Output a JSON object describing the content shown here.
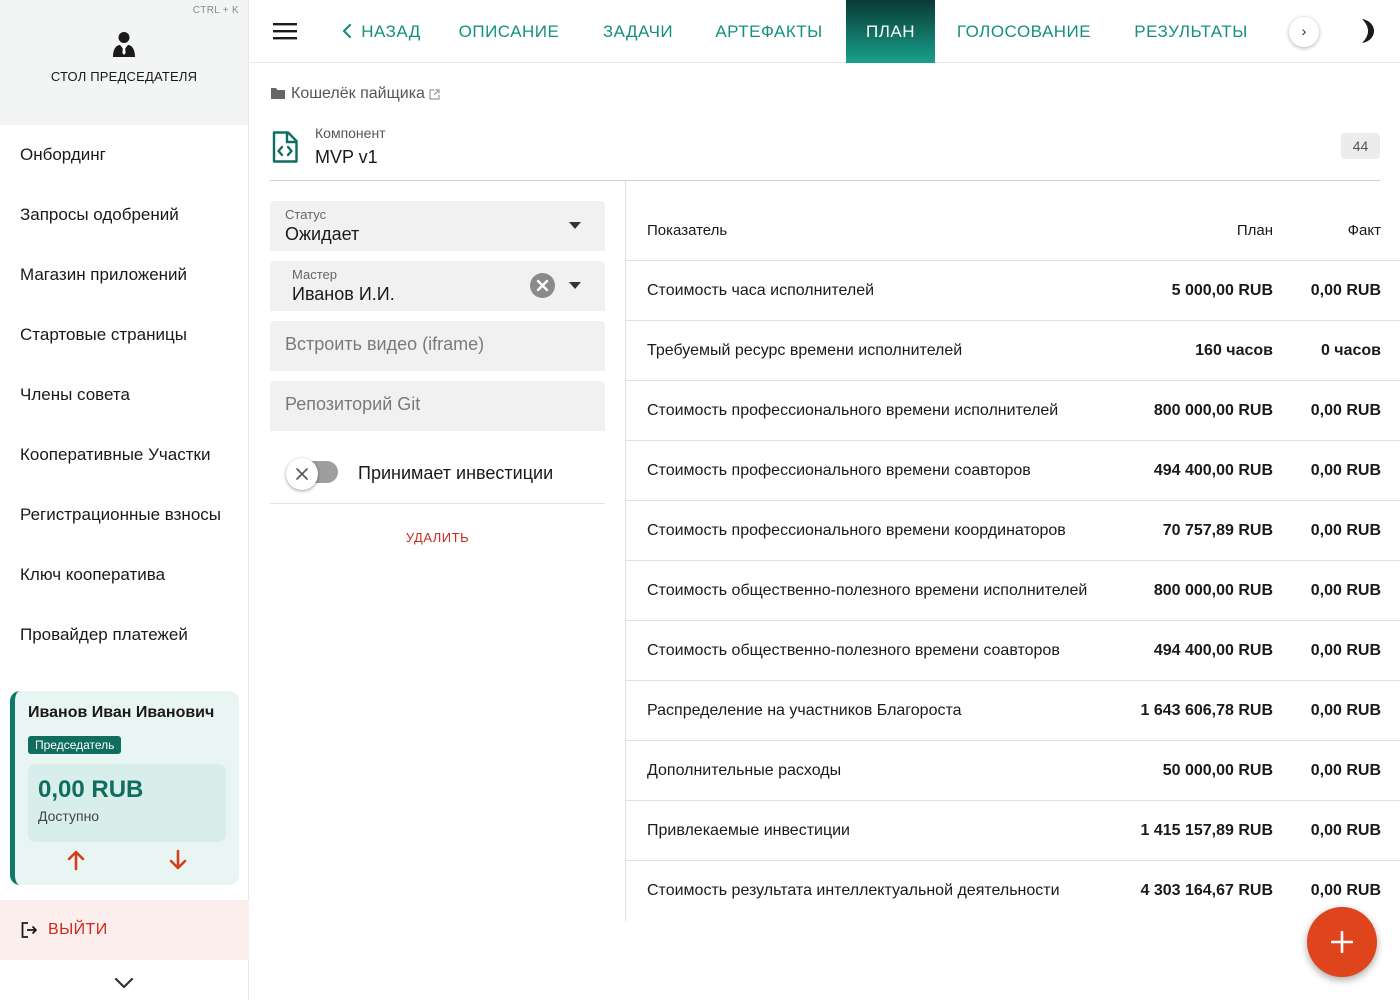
{
  "sidebar": {
    "shortcut": "CTRL + K",
    "workspace_title": "СТОЛ ПРЕДСЕДАТЕЛЯ",
    "items": [
      {
        "label": "Онбординг"
      },
      {
        "label": "Запросы одобрений"
      },
      {
        "label": "Магазин приложений"
      },
      {
        "label": "Стартовые страницы"
      },
      {
        "label": "Члены совета"
      },
      {
        "label": "Кооперативные Участки"
      },
      {
        "label": "Регистрационные взносы"
      },
      {
        "label": "Ключ кооператива"
      },
      {
        "label": "Провайдер платежей"
      }
    ],
    "user": {
      "name": "Иванов Иван Иванович",
      "role": "Председатель",
      "balance": "0,00 RUB",
      "balance_label": "Доступно"
    },
    "logout_label": "ВЫЙТИ"
  },
  "topbar": {
    "back_label": "НАЗАД",
    "tabs": [
      {
        "label": "ОПИСАНИЕ"
      },
      {
        "label": "ЗАДАЧИ"
      },
      {
        "label": "АРТЕФАКТЫ"
      },
      {
        "label": "ПЛАН"
      },
      {
        "label": "ГОЛОСОВАНИЕ"
      },
      {
        "label": "РЕЗУЛЬТАТЫ"
      }
    ],
    "active_tab": "ПЛАН",
    "scroll_glyph": "›"
  },
  "header": {
    "breadcrumb": "Кошелёк пайщика",
    "component_type": "Компонент",
    "component_name": "MVP v1",
    "badge": "44"
  },
  "form": {
    "status_label": "Статус",
    "status_value": "Ожидает",
    "master_label": "Мастер",
    "master_value": "Иванов И.И.",
    "video_placeholder": "Встроить видео (iframe)",
    "git_placeholder": "Репозиторий Git",
    "invest_toggle_label": "Принимает инвестиции",
    "invest_toggle_on": false,
    "delete_label": "УДАЛИТЬ"
  },
  "table": {
    "headers": {
      "name": "Показатель",
      "plan": "План",
      "fact": "Факт"
    },
    "rows": [
      {
        "name": "Стоимость часа исполнителей",
        "plan": "5 000,00 RUB",
        "fact": "0,00 RUB"
      },
      {
        "name": "Требуемый ресурс времени исполнителей",
        "plan": "160 часов",
        "fact": "0 часов"
      },
      {
        "name": "Стоимость профессионального времени исполнителей",
        "plan": "800 000,00 RUB",
        "fact": "0,00 RUB"
      },
      {
        "name": "Стоимость профессионального времени соавторов",
        "plan": "494 400,00 RUB",
        "fact": "0,00 RUB"
      },
      {
        "name": "Стоимость профессионального времени координаторов",
        "plan": "70 757,89 RUB",
        "fact": "0,00 RUB"
      },
      {
        "name": "Стоимость общественно-полезного времени исполнителей",
        "plan": "800 000,00 RUB",
        "fact": "0,00 RUB"
      },
      {
        "name": "Стоимость общественно-полезного времени соавторов",
        "plan": "494 400,00 RUB",
        "fact": "0,00 RUB"
      },
      {
        "name": "Распределение на участников Благороста",
        "plan": "1 643 606,78 RUB",
        "fact": "0,00 RUB"
      },
      {
        "name": "Дополнительные расходы",
        "plan": "50 000,00 RUB",
        "fact": "0,00 RUB"
      },
      {
        "name": "Привлекаемые инвестиции",
        "plan": "1 415 157,89 RUB",
        "fact": "0,00 RUB"
      },
      {
        "name": "Стоимость результата интеллектуальной деятельности",
        "plan": "4 303 164,67 RUB",
        "fact": "0,00 RUB"
      }
    ]
  },
  "colors": {
    "accent": "#14907f",
    "active_tab_dark": "#0a3a34",
    "danger": "#cc2a1c",
    "fab": "#e0441c",
    "balance": "#0f6e60"
  },
  "icons": {
    "workspace": "user-tie-icon",
    "menu": "hamburger-icon",
    "back": "chevron-left-icon",
    "theme": "moon-icon",
    "breadcrumb": "folder-icon",
    "external": "external-link-icon",
    "component": "code-file-icon",
    "deposit": "arrow-up-icon",
    "withdraw": "arrow-down-icon",
    "logout": "logout-icon",
    "fab": "plus-icon"
  }
}
